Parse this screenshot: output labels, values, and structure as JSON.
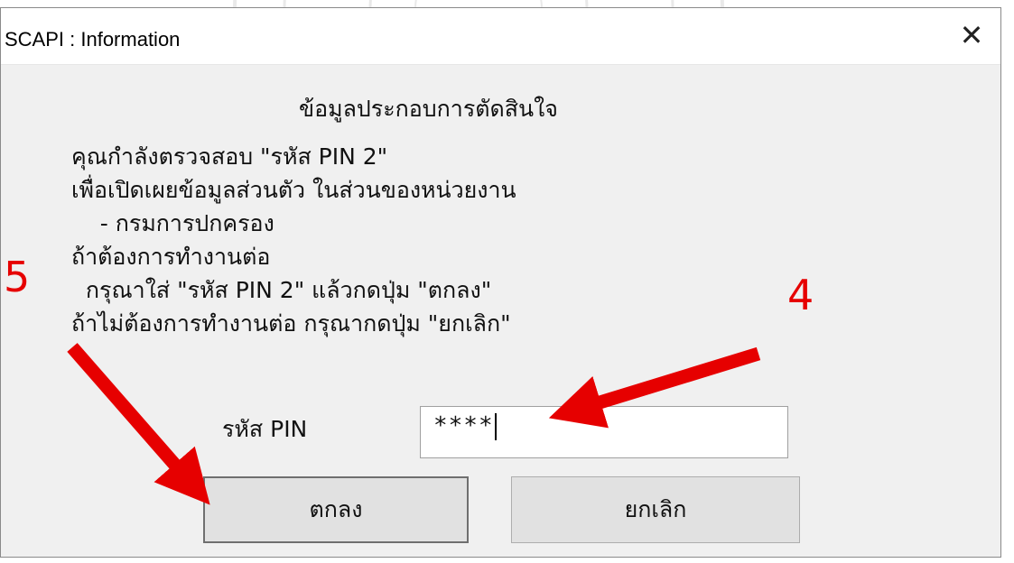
{
  "window": {
    "title": "SCAPI : Information"
  },
  "dialog": {
    "heading": "ข้อมูลประกอบการตัดสินใจ",
    "lines": [
      "คุณกำลังตรวจสอบ \"รหัส PIN 2\"",
      "เพื่อเปิดเผยข้อมูลส่วนตัว ในส่วนของหน่วยงาน",
      "    - กรมการปกครอง",
      "ถ้าต้องการทำงานต่อ",
      "  กรุณาใส่ \"รหัส PIN 2\" แล้วกดปุ่ม \"ตกลง\"",
      "ถ้าไม่ต้องการทำงานต่อ กรุณากดปุ่ม \"ยกเลิก\""
    ],
    "pin_label": "รหัส PIN",
    "pin_value": "****",
    "ok_label": "ตกลง",
    "cancel_label": "ยกเลิก"
  },
  "annotations": {
    "step_ok": "5",
    "step_pin": "4",
    "color": "#e60000"
  },
  "icons": {
    "close": "close-icon",
    "watermark": "university-seal-watermark"
  }
}
